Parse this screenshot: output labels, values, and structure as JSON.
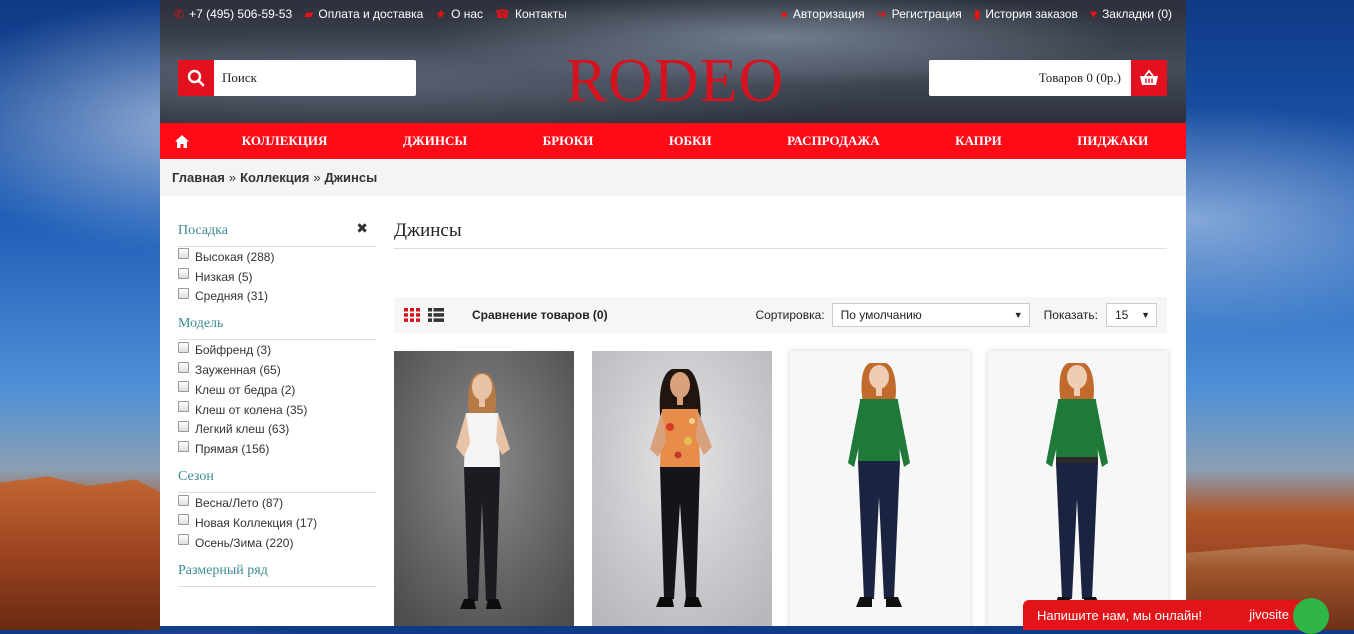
{
  "topbar": {
    "left": [
      {
        "icon": "phone-icon",
        "label": "+7 (495) 506-59-53"
      },
      {
        "icon": "truck-icon",
        "label": "Оплата и доставка"
      },
      {
        "icon": "star-icon",
        "label": "О нас"
      },
      {
        "icon": "phone-old-icon",
        "label": "Контакты"
      }
    ],
    "right": [
      {
        "icon": "user-icon",
        "label": "Авторизация"
      },
      {
        "icon": "arrow-right-icon",
        "label": "Регистрация"
      },
      {
        "icon": "book-icon",
        "label": "История заказов"
      },
      {
        "icon": "heart-icon",
        "label": "Закладки (0)"
      }
    ]
  },
  "search": {
    "placeholder": "Поиск"
  },
  "logo": {
    "text": "RODEO"
  },
  "cart": {
    "label": "Товаров 0 (0р.)"
  },
  "nav": {
    "items": [
      "КОЛЛЕКЦИЯ",
      "ДЖИНСЫ",
      "БРЮКИ",
      "ЮБКИ",
      "РАСПРОДАЖА",
      "КАПРИ",
      "ПИДЖАКИ"
    ]
  },
  "breadcrumb": [
    "Главная",
    "Коллекция",
    "Джинсы"
  ],
  "filters": [
    {
      "title": "Посадка",
      "options": [
        "Высокая (288)",
        "Низкая (5)",
        "Средняя (31)"
      ]
    },
    {
      "title": "Модель",
      "options": [
        "Бойфренд (3)",
        "Зауженная (65)",
        "Клеш от бедра (2)",
        "Клеш от колена (35)",
        "Легкий клеш (63)",
        "Прямая (156)"
      ]
    },
    {
      "title": "Сезон",
      "options": [
        "Весна/Лето (87)",
        "Новая Коллекция (17)",
        "Осень/Зима (220)"
      ]
    },
    {
      "title": "Размерный ряд",
      "options": []
    }
  ],
  "main": {
    "title": "Джинсы",
    "compare": "Сравнение товаров (0)",
    "sort_label": "Сортировка:",
    "sort_value": "По умолчанию",
    "show_label": "Показать:",
    "show_value": "15"
  },
  "chat": {
    "text": "Напишите нам, мы онлайн!",
    "brand": "jivosite"
  },
  "colors": {
    "accent": "#ff0a17",
    "filter_title": "#3b8c95",
    "logo": "#d7121f"
  }
}
